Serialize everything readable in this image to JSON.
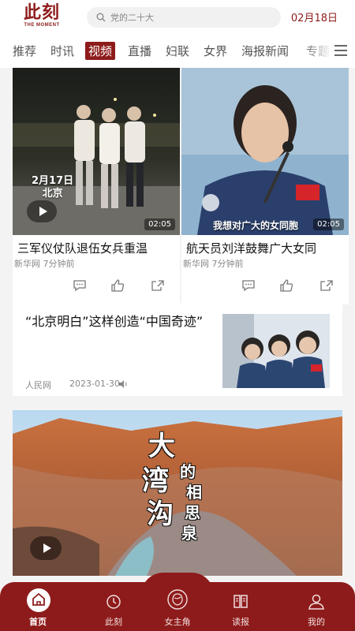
{
  "header": {
    "logo_text": "此刻",
    "logo_sub": "THE MOMENT",
    "search_placeholder": "党的二十大",
    "date": "02月18日"
  },
  "tabs": [
    "推荐",
    "时讯",
    "视频",
    "直播",
    "妇联",
    "女界",
    "海报新闻",
    "专题"
  ],
  "active_tab": "视频",
  "videos": [
    {
      "title": "三军仪仗队退伍女兵重温",
      "source": "新华网 7分钟前",
      "overlay_date": "2月17日",
      "overlay_city": "北京",
      "duration": "02:05"
    },
    {
      "title": "航天员刘洋鼓舞广大女同",
      "source": "新华网 7分钟前",
      "overlay_caption": "我想对广大的女同胞",
      "duration": "02:05"
    }
  ],
  "news": {
    "title": "“北京明白”这样创造“中国奇迹”",
    "source": "人民网",
    "time": "2023-01-30"
  },
  "banner": {
    "chars": [
      "大",
      "湾",
      "沟",
      "的",
      "相",
      "思",
      "泉"
    ]
  },
  "bottom_nav": [
    {
      "label": "首页",
      "icon": "home-icon"
    },
    {
      "label": "此刻",
      "icon": "clock-icon"
    },
    {
      "label": "女主角",
      "icon": "woman-icon"
    },
    {
      "label": "读报",
      "icon": "newspaper-icon"
    },
    {
      "label": "我的",
      "icon": "user-icon"
    }
  ],
  "colors": {
    "brand": "#8e1b1b",
    "background": "#f3f3f3"
  }
}
